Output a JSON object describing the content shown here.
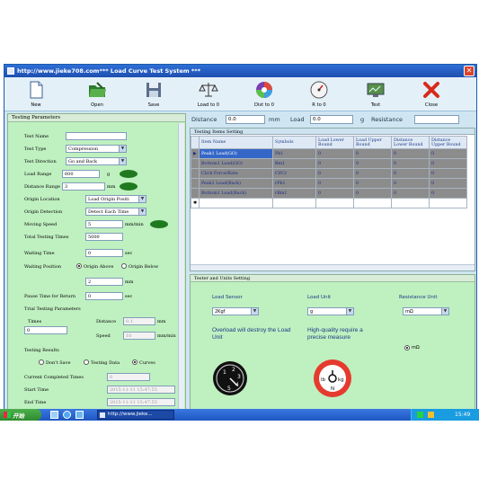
{
  "window": {
    "title": "http://www.jieke708.com*** Load Curve Test System ***",
    "close_glyph": "✕"
  },
  "toolbar": [
    {
      "label": "New",
      "icon": "document-icon"
    },
    {
      "label": "Open",
      "icon": "folder-icon"
    },
    {
      "label": "Save",
      "icon": "floppy-disk-icon"
    },
    {
      "label": "Load to 0",
      "icon": "balance-scale-icon"
    },
    {
      "label": "Dist to 0",
      "icon": "color-wheel-icon"
    },
    {
      "label": "R to 0",
      "icon": "gauge-icon"
    },
    {
      "label": "Test",
      "icon": "monitor-chart-icon"
    },
    {
      "label": "Close",
      "icon": "red-x-icon"
    }
  ],
  "testing_params": {
    "header": "Testing Parameters",
    "test_name_label": "Test Name",
    "test_name_value": "",
    "test_type_label": "Test Type",
    "test_type_value": "Compression",
    "test_direction_label": "Test Direction",
    "test_direction_value": "Go and Back",
    "load_range_label": "Load Range",
    "load_range_value": "600",
    "load_range_unit": "g",
    "distance_range_label": "Distance Range",
    "distance_range_value": "3",
    "distance_range_unit": "mm",
    "origin_location_label": "Origin Location",
    "origin_location_value": "Load Origin Positi",
    "origin_detection_label": "Origin Detection",
    "origin_detection_value": "Detect Each Time",
    "moving_speed_label": "Moving Speed",
    "moving_speed_value": "5",
    "moving_speed_unit": "mm/min",
    "total_testing_times_label": "Total Testing Times",
    "total_testing_times_value": "5000",
    "waiting_time_label": "Waiting Time",
    "waiting_time_value": "0",
    "waiting_time_unit": "sec",
    "waiting_position_label": "Waiting Position",
    "origin_above_label": "Origin Above",
    "origin_below_label": "Origin Below",
    "waiting_position_value": "2",
    "waiting_position_unit": "mm",
    "pause_time_label": "Pause Time for Return",
    "pause_time_value": "0",
    "pause_time_unit": "sec"
  },
  "trial_params": {
    "header": "Trial Testing Parameters",
    "times_label": "Times",
    "times_value": "0",
    "distance_label": "Distance",
    "distance_value": "0.1",
    "distance_unit": "mm",
    "speed_label": "Speed",
    "speed_value": "10",
    "speed_unit": "mm/min"
  },
  "testing_results": {
    "header": "Testing Results",
    "dont_save_label": "Don't Save",
    "testing_data_label": "Testing Data",
    "curves_label": "Curves",
    "completed_times_label": "Current Completed Times",
    "completed_times_value": "0",
    "start_time_label": "Start Time",
    "start_time_value": "2015-11-11 15:47:55",
    "end_time_label": "End Time",
    "end_time_value": "2015-11-11 15:47:55"
  },
  "readouts": {
    "distance_label": "Distance",
    "distance_value": "0.0",
    "distance_unit": "mm",
    "load_label": "Load",
    "load_value": "0.0",
    "load_unit": "g",
    "resistance_label": "Resistance",
    "resistance_value": ""
  },
  "items_grid": {
    "header": "Testing Items Setting",
    "columns": [
      "Item Name",
      "Symbols",
      "Load Lower Bound",
      "Load Upper Bound",
      "Distance Lower Bound",
      "Distance Upper Bound"
    ],
    "rows": [
      [
        "Peak1 Load(GO)",
        "Pk1",
        "0",
        "0",
        "0",
        "0"
      ],
      [
        "Bottom1 Load(GO)",
        "Bm1",
        "0",
        "0",
        "0",
        "0"
      ],
      [
        "Click Force/Rate",
        "Cf/Cr",
        "0",
        "0",
        "0",
        "0"
      ],
      [
        "Peak1 Load(Back)",
        "rPk1",
        "0",
        "0",
        "0",
        "0"
      ],
      [
        "Bottom1 Load(Back)",
        "rBm1",
        "0",
        "0",
        "0",
        "0"
      ]
    ],
    "row_marker": "▶",
    "new_row_marker": "✱"
  },
  "units": {
    "header": "Tester and Units Setting",
    "load_sensor_label": "Load Sensor",
    "load_sensor_value": "2Kgf",
    "load_sensor_note": "Overload will destroy the Load Unit",
    "load_unit_label": "Load Unit",
    "load_unit_value": "g",
    "load_unit_note": "High-quality require a precise measure",
    "resistance_unit_label": "Resistance Unit",
    "resistance_unit_value": "mΩ",
    "resistance_radio_label": "mΩ",
    "dial_labels": {
      "n1": "1",
      "n2": "2",
      "n3": "3",
      "n4": "4",
      "n5": "5"
    },
    "sign_labels": {
      "lb": "lb",
      "kg": "kg",
      "n": "N"
    }
  },
  "taskbar": {
    "start_label": "开始",
    "task_label": "http://www.jieke...",
    "clock": "15:49"
  },
  "colors": {
    "window_bg": "#cfe6f2",
    "panel_green": "#bff0c0",
    "title_blue": "#1e4fb0",
    "selected_cell": "#3567c8",
    "row_gray": "#8c8c8c"
  }
}
